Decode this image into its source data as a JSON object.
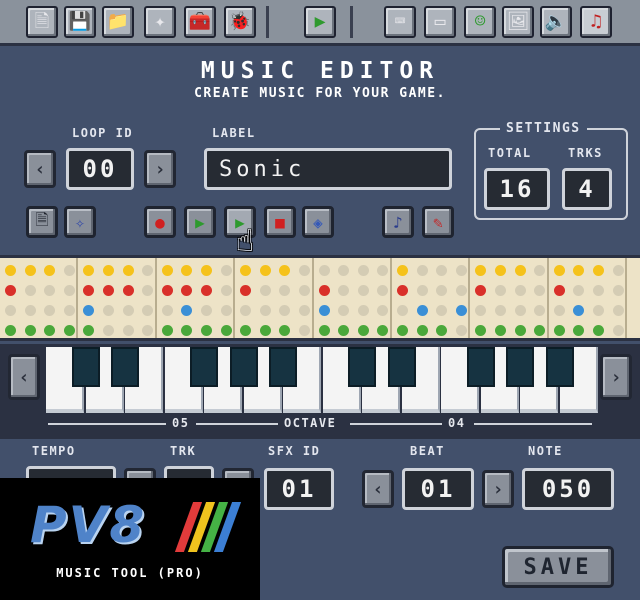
{
  "toolbar": {
    "icons": [
      "file-icon",
      "floppy-save-icon",
      "folder-icon",
      "tilemap-icon",
      "toolbox-icon",
      "sprite-bug-icon",
      "play-icon",
      "code-icon",
      "screen-icon",
      "face-icon",
      "picture-icon",
      "speaker-icon",
      "music-note-icon"
    ],
    "glyphs": [
      "🗎",
      "💾",
      "📁",
      "✦",
      "🧰",
      "🐞",
      "▶",
      "⌨",
      "▭",
      "☺",
      "🖼",
      "🔈",
      "♫"
    ]
  },
  "header": {
    "title": "MUSIC EDITOR",
    "subtitle": "CREATE MUSIC FOR YOUR GAME."
  },
  "loop": {
    "label": "LOOP ID",
    "value": "00",
    "prev": "‹",
    "next": "›"
  },
  "name": {
    "label": "LABEL",
    "value": "Sonic"
  },
  "settings": {
    "title": "SETTINGS",
    "total_label": "TOTAL",
    "total_value": "16",
    "trks_label": "TRKS",
    "trks_value": "4"
  },
  "transport": {
    "record": "●",
    "play": "▶",
    "play_loop": "▶",
    "stop": "■",
    "tempo": "◈"
  },
  "octave": {
    "label": "OCTAVE",
    "left": "05",
    "right": "04",
    "prev": "‹",
    "next": "›"
  },
  "bottom": {
    "tempo_label": "TEMPO",
    "trk_label": "TRK",
    "sfx_label": "SFX ID",
    "sfx_value": "01",
    "beat_label": "BEAT",
    "beat_value": "01",
    "beat_prev": "‹",
    "beat_next": "›",
    "note_label": "NOTE",
    "note_value": "050"
  },
  "logo": {
    "text": "PV8",
    "subtitle": "MUSIC TOOL (PRO)"
  },
  "save_label": "SAVE",
  "colors": {
    "track1": "#f5c21b",
    "track2": "#d9302a",
    "track3": "#3a8fd6",
    "track4": "#4aa83a",
    "empty": "#d4ccb4"
  },
  "grid": {
    "tracks": [
      [
        1,
        1,
        1,
        0,
        1,
        1,
        1,
        0,
        1,
        1,
        1,
        0,
        1,
        1,
        1,
        0,
        0,
        0,
        0,
        0,
        1,
        0,
        0,
        0,
        1,
        1,
        1,
        0,
        1,
        1,
        1,
        0
      ],
      [
        1,
        0,
        0,
        0,
        1,
        1,
        1,
        0,
        1,
        1,
        1,
        0,
        1,
        0,
        0,
        0,
        1,
        0,
        0,
        0,
        1,
        0,
        0,
        0,
        1,
        0,
        0,
        0,
        1,
        0,
        0,
        0
      ],
      [
        0,
        0,
        0,
        0,
        1,
        0,
        0,
        0,
        0,
        1,
        0,
        0,
        0,
        0,
        0,
        0,
        1,
        0,
        0,
        0,
        0,
        1,
        0,
        1,
        0,
        0,
        0,
        0,
        0,
        1,
        0,
        0
      ],
      [
        1,
        1,
        1,
        1,
        1,
        0,
        0,
        0,
        1,
        1,
        1,
        1,
        1,
        1,
        1,
        0,
        1,
        1,
        1,
        1,
        1,
        1,
        1,
        0,
        1,
        1,
        1,
        1,
        1,
        1,
        1,
        0
      ]
    ]
  }
}
